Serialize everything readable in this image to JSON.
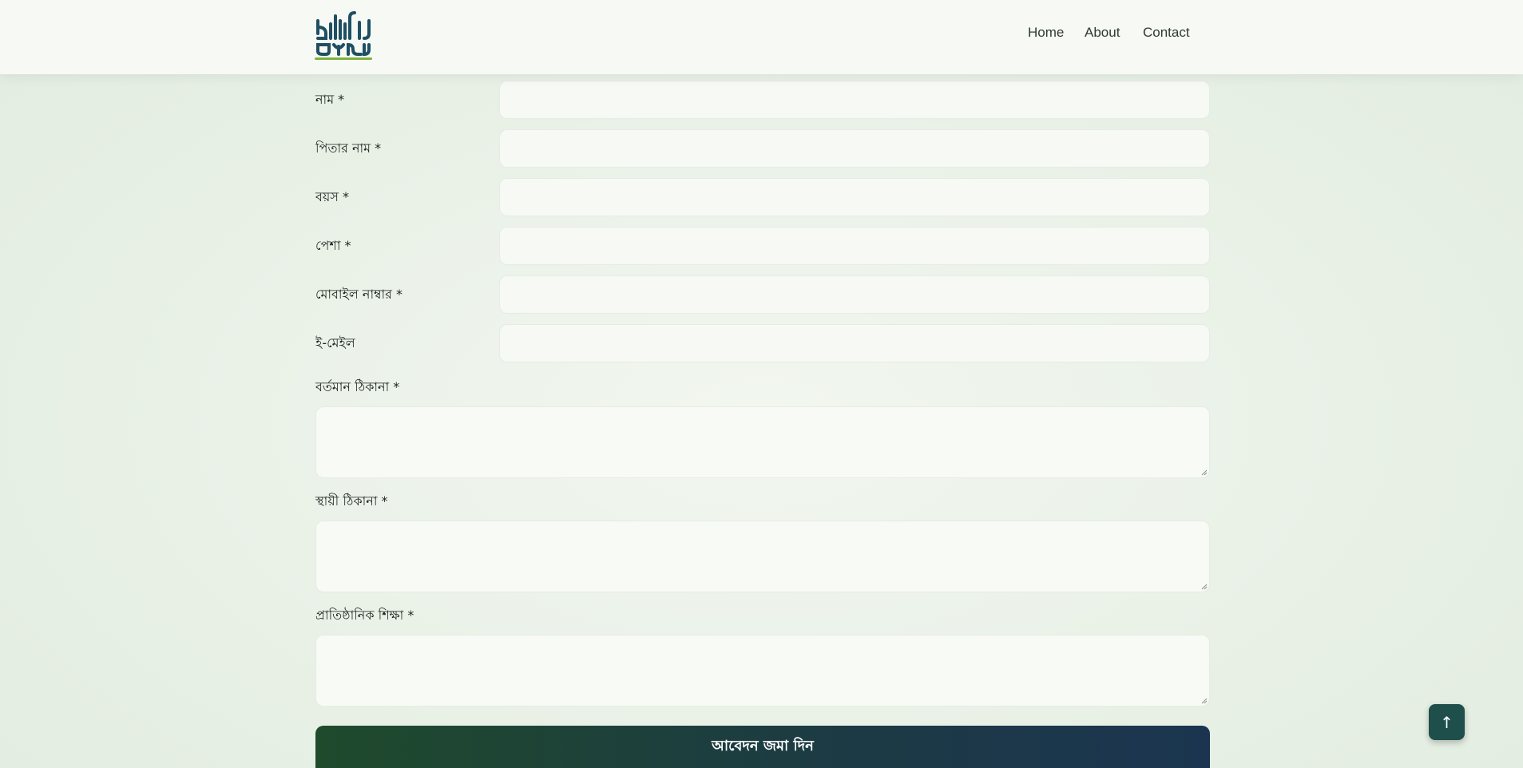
{
  "header": {
    "logo_alt": "madrasa logo",
    "nav": [
      {
        "label": "Home"
      },
      {
        "label": "About"
      },
      {
        "label": "Contact"
      }
    ]
  },
  "form": {
    "fields": [
      {
        "label": "নাম *",
        "type": "input",
        "value": ""
      },
      {
        "label": "পিতার নাম *",
        "type": "input",
        "value": ""
      },
      {
        "label": "বয়স *",
        "type": "input",
        "value": ""
      },
      {
        "label": "পেশা *",
        "type": "input",
        "value": ""
      },
      {
        "label": "মোবাইল নাম্বার *",
        "type": "input",
        "value": ""
      },
      {
        "label": "ই-মেইল",
        "type": "input",
        "value": ""
      },
      {
        "label": "বর্তমান ঠিকানা *",
        "type": "textarea",
        "value": ""
      },
      {
        "label": "স্থায়ী ঠিকানা *",
        "type": "textarea",
        "value": ""
      },
      {
        "label": "প্রাতিষ্ঠানিক শিক্ষা *",
        "type": "textarea",
        "value": ""
      }
    ],
    "submit_label": "আবেদন জমা দিন"
  },
  "scroll_top": {
    "icon": "arrow-up-icon",
    "glyph": "↑"
  },
  "colors": {
    "background": "#e9f1e7",
    "header": "#f6f9f4",
    "input": "#f6f9f4",
    "submit_gradient_start": "#1f4a2c",
    "submit_gradient_end": "#1b3550",
    "scroll_top": "#1f4f4a",
    "logo_primary": "#1f4f63",
    "logo_accent": "#7bb33e"
  }
}
